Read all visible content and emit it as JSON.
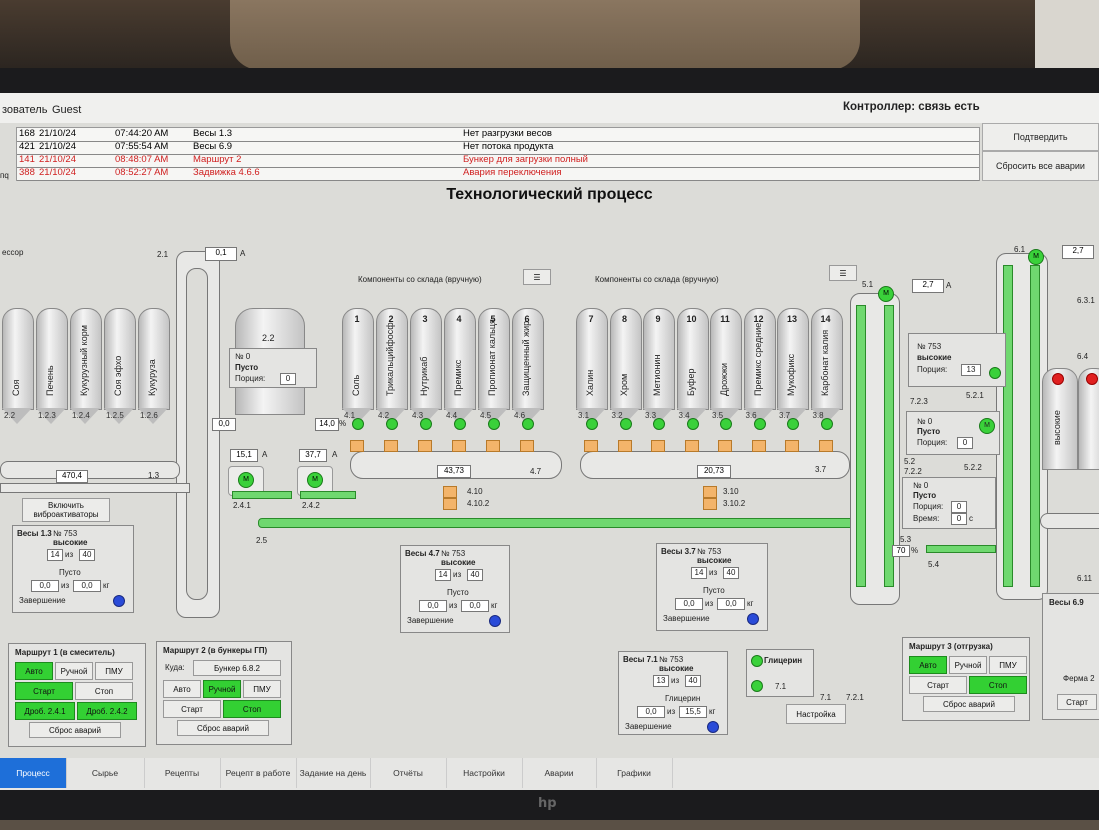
{
  "topbar": {
    "user_label": "зователь",
    "user_value": "Guest",
    "controller": "Контроллер: связь есть"
  },
  "alarms": [
    {
      "id": "168",
      "date": "21/10/24",
      "time": "07:44:20 AM",
      "source": "Весы 1.3",
      "message": "Нет разгрузки весов",
      "severity": "normal"
    },
    {
      "id": "421",
      "date": "21/10/24",
      "time": "07:55:54 AM",
      "source": "Весы 6.9",
      "message": "Нет потока продукта",
      "severity": "normal"
    },
    {
      "id": "141",
      "date": "21/10/24",
      "time": "08:48:07 AM",
      "source": "Маршрут 2",
      "message": "Бункер для загрузки полный",
      "severity": "alarm"
    },
    {
      "id": "388",
      "date": "21/10/24",
      "time": "08:52:27 AM",
      "source": "Задвижка 4.6.6",
      "message": "Авария переключения",
      "severity": "alarm"
    }
  ],
  "alarm_buttons": {
    "confirm": "Подтвердить",
    "reset": "Сбросить все аварии"
  },
  "row_fragment": "пq",
  "page_title": "Технологический процесс",
  "left_label": "ессор",
  "elevator_a": {
    "id": "2.1",
    "value": "0,1",
    "unit": "A"
  },
  "elevator_b": {
    "id": "5.1",
    "value": "2,7",
    "unit": "A"
  },
  "elevator_c": {
    "id": "6.1",
    "value": "2,7"
  },
  "warehouse_labels": [
    "Компоненты со склада (вручную)",
    "Компоненты со склада (вручную)"
  ],
  "silos_left": [
    {
      "label": "Соя",
      "id": "2.2"
    },
    {
      "label": "Печень",
      "id": "1.2.3"
    },
    {
      "label": "Кукурузный корм",
      "id": "1.2.4"
    },
    {
      "label": "Соя эфхо",
      "id": "1.2.5"
    },
    {
      "label": "Кукуруза",
      "id": "1.2.6"
    }
  ],
  "hopper_22": {
    "id": "2.2",
    "no": "№ 0",
    "state": "Пусто",
    "portion_label": "Порция:",
    "portion": "0"
  },
  "silos_mid": [
    {
      "num": "1",
      "label": "Соль",
      "id": "4.1"
    },
    {
      "num": "2",
      "label": "Трикальцийфосф",
      "id": "4.2"
    },
    {
      "num": "3",
      "label": "Нутрикаб",
      "id": "4.3"
    },
    {
      "num": "4",
      "label": "Премикс",
      "id": "4.4"
    },
    {
      "num": "5",
      "label": "Пропионат кальця",
      "id": "4.5"
    },
    {
      "num": "6",
      "label": "Защищенный жир",
      "id": "4.6"
    }
  ],
  "silos_right": [
    {
      "num": "7",
      "label": "Халин",
      "id": "3.1"
    },
    {
      "num": "8",
      "label": "Хром",
      "id": "3.2"
    },
    {
      "num": "9",
      "label": "Метионин",
      "id": "3.3"
    },
    {
      "num": "10",
      "label": "Буфер",
      "id": "3.4"
    },
    {
      "num": "11",
      "label": "Дрожжи",
      "id": "3.5"
    },
    {
      "num": "12",
      "label": "Премикс средние",
      "id": "3.6"
    },
    {
      "num": "13",
      "label": "Мукофикс",
      "id": "3.7"
    },
    {
      "num": "14",
      "label": "Карбонат калия",
      "id": "3.8"
    }
  ],
  "readouts": {
    "r00": "0,0",
    "r140": "14,0",
    "pct": "%",
    "motor1": "15,1",
    "motor2": "37,7",
    "unitA": "A",
    "conv13": "470,4",
    "conv13id": "1.3",
    "conv47": "43,73",
    "conv47id": "4.7",
    "conv37": "20,73",
    "conv37id": "3.7",
    "id241": "2.4.1",
    "id242": "2.4.2",
    "id25": "2.5",
    "id410": "4.10",
    "id4102": "4.10.2",
    "id310": "3.10",
    "id3102": "3.10.2"
  },
  "vibro_button": "Включить виброактиваторы",
  "scale_13": {
    "title": "Весы 1.3",
    "no": "№ 753",
    "mode": "высокие",
    "cur": "14",
    "of": "из",
    "total": "40",
    "state": "Пусто",
    "v1": "0,0",
    "v2": "0,0",
    "unit": "кг",
    "done": "Завершение"
  },
  "scale_47": {
    "title": "Весы 4.7",
    "no": "№ 753",
    "mode": "высокие",
    "cur": "14",
    "of": "из",
    "total": "40",
    "state": "Пусто",
    "v1": "0,0",
    "v2": "0,0",
    "unit": "кг",
    "done": "Завершение"
  },
  "scale_37": {
    "title": "Весы 3.7",
    "no": "№ 753",
    "mode": "высокие",
    "cur": "14",
    "of": "из",
    "total": "40",
    "state": "Пусто",
    "v1": "0,0",
    "v2": "0,0",
    "unit": "кг",
    "done": "Завершение"
  },
  "scale_71": {
    "title": "Весы 7.1",
    "no": "№ 753",
    "mode": "высокие",
    "cur": "13",
    "of": "из",
    "total": "40",
    "state": "Глицерин",
    "v1": "0,0",
    "v2": "15,5",
    "unit": "кг",
    "done": "Завершение"
  },
  "glycerin": {
    "label": "Глицерин",
    "id": "7.1",
    "ids": [
      "7.1",
      "7.2.1"
    ],
    "settings": "Настройка"
  },
  "right_panel_753": {
    "no": "№ 753",
    "mode": "высокие",
    "portion_label": "Порция:",
    "portion": "13",
    "id": "5.2.1",
    "ids": [
      "7.2.3"
    ]
  },
  "right_panel_0a": {
    "no": "№ 0",
    "state": "Пусто",
    "portion_label": "Порция:",
    "portion": "0",
    "ids": [
      "5.2",
      "7.2.2",
      "5.2.2"
    ]
  },
  "right_panel_0b": {
    "no": "№ 0",
    "state": "Пусто",
    "portion_label": "Порция:",
    "portion": "0",
    "time_label": "Время:",
    "time": "0",
    "unit": "с",
    "ids": [
      "5.3",
      "70",
      "%",
      "5.4"
    ]
  },
  "route_1": {
    "title": "Маршрут 1 (в смеситель)",
    "auto": "Авто",
    "manual": "Ручной",
    "pmu": "ПМУ",
    "start": "Старт",
    "stop": "Стоп",
    "d1": "Дроб. 2.4.1",
    "d2": "Дроб. 2.4.2",
    "reset": "Сброс аварий"
  },
  "route_2": {
    "title": "Маршрут 2 (в бункеры ГП)",
    "where_label": "Куда:",
    "where": "Бункер 6.8.2",
    "auto": "Авто",
    "manual": "Ручной",
    "pmu": "ПМУ",
    "start": "Старт",
    "stop": "Стоп",
    "reset": "Сброс аварий"
  },
  "route_3": {
    "title": "Маршрут 3 (отгрузка)",
    "auto": "Авто",
    "manual": "Ручной",
    "pmu": "ПМУ",
    "start": "Старт",
    "stop": "Стоп",
    "reset": "Сброс аварий"
  },
  "right_edge": {
    "scale": "Весы 6.9",
    "farm": "Ферма 2",
    "start": "Старт",
    "ids": [
      "6.3.1",
      "6.4",
      "6.11"
    ],
    "mode": "высокие"
  },
  "nav": [
    "Процесс",
    "Сырье",
    "Рецепты",
    "Рецепт в работе",
    "Задание на день",
    "Отчёты",
    "Настройки",
    "Аварии",
    "Графики"
  ],
  "colors": {
    "green": "#33d033",
    "alarm": "#d02020",
    "nav_active": "#1e6fd9"
  }
}
